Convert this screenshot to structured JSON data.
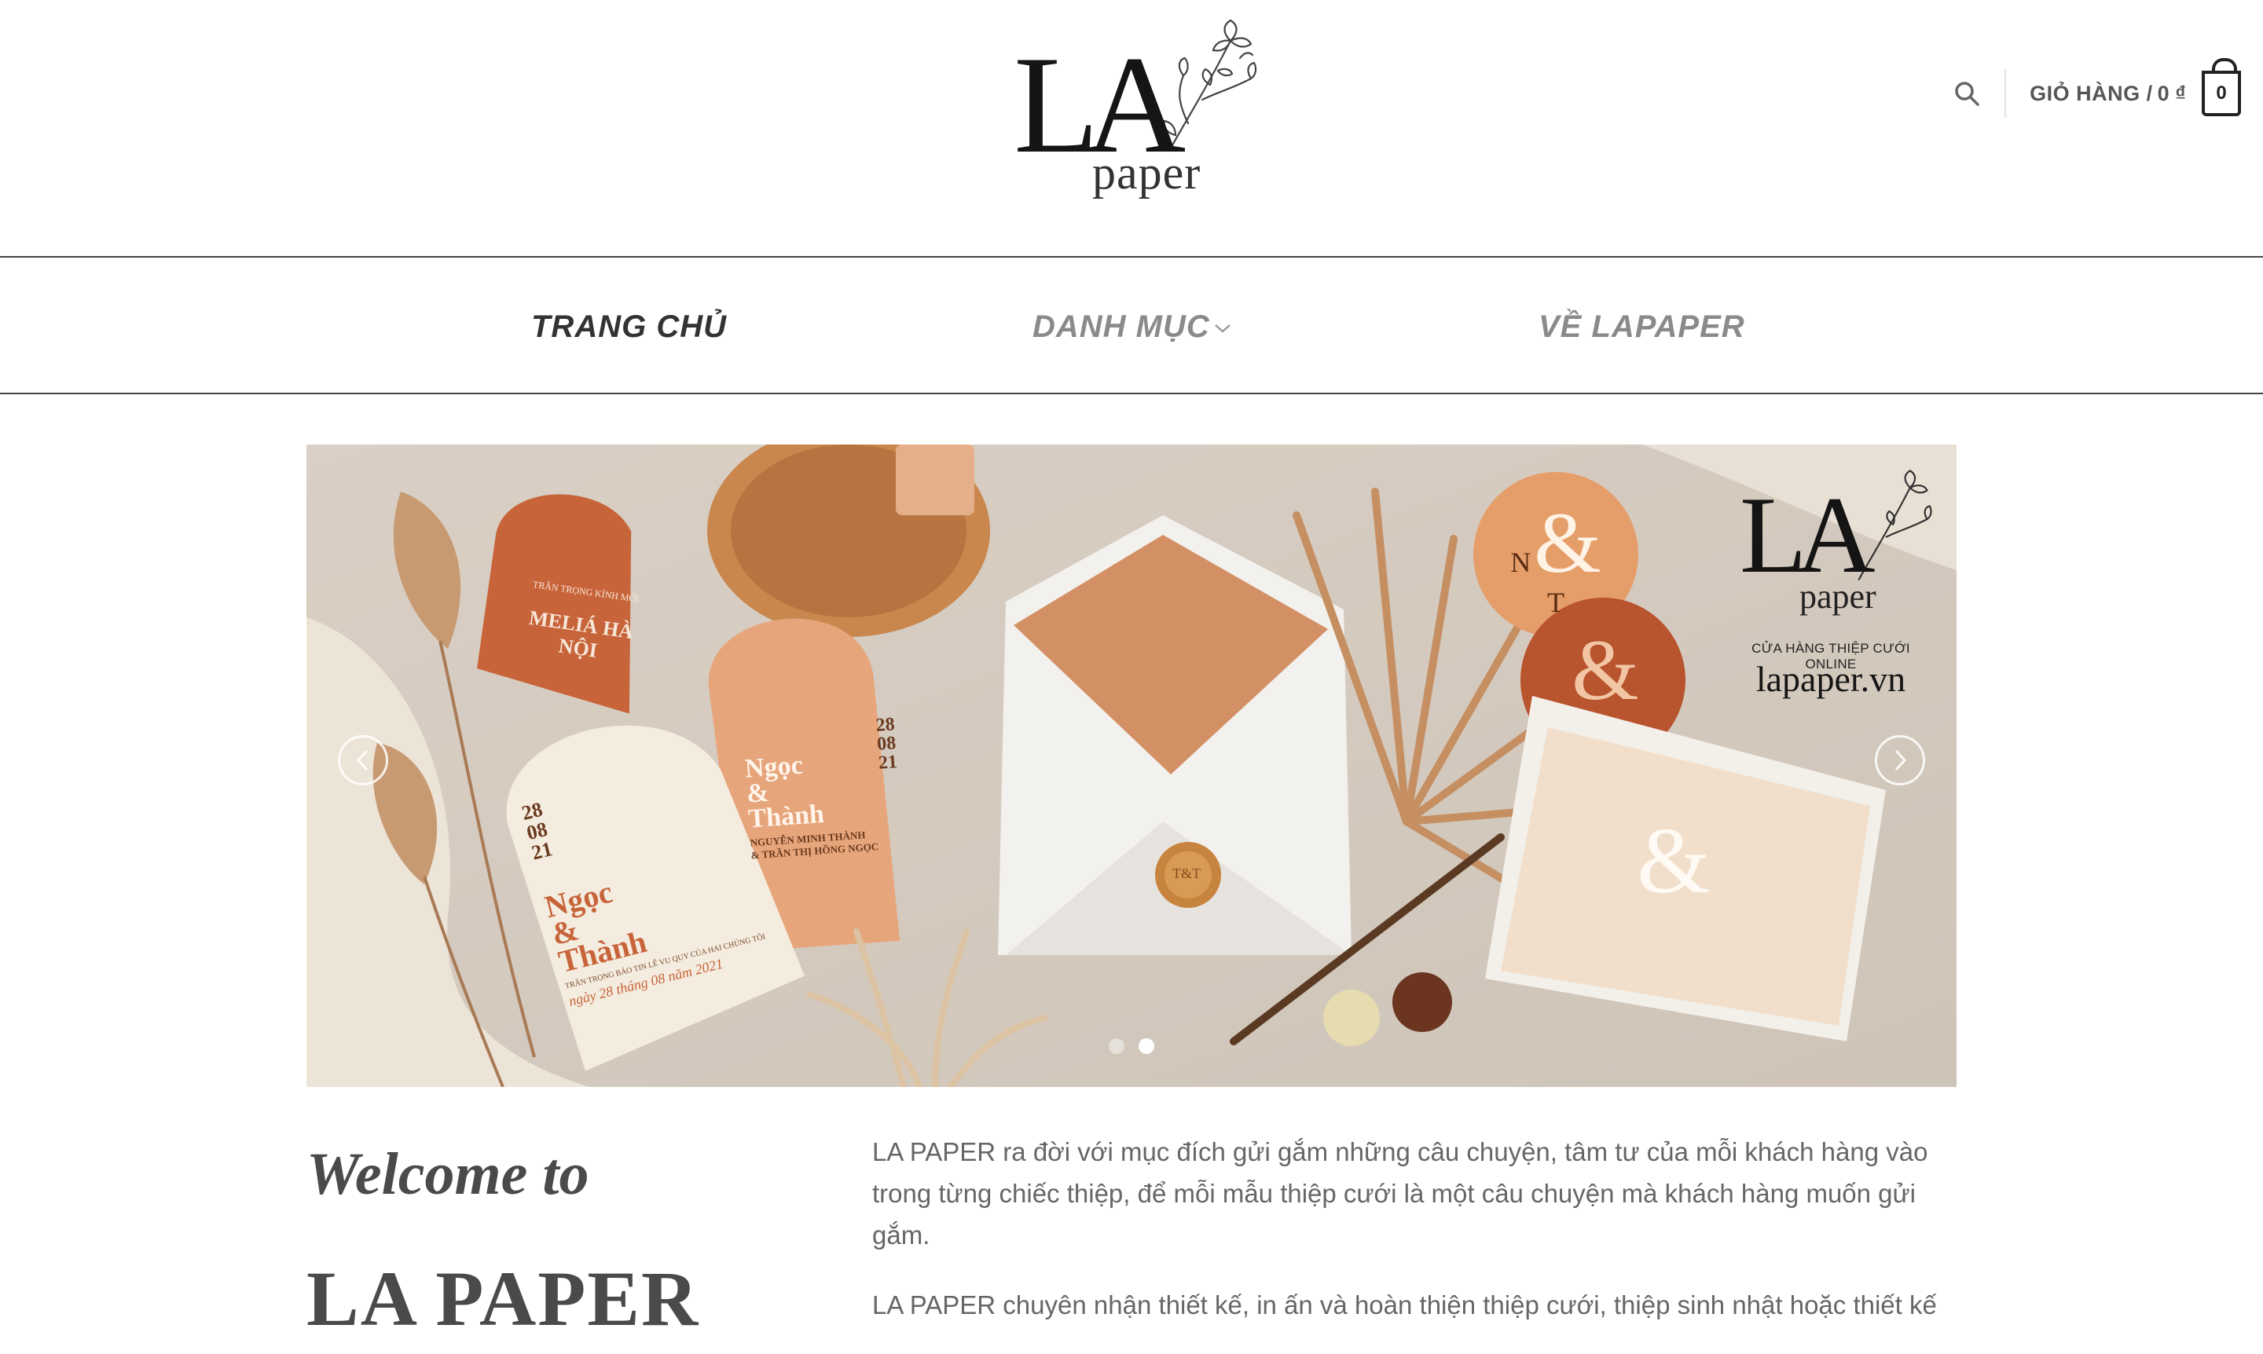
{
  "header": {
    "logo": {
      "main": "LA",
      "sub": "paper"
    },
    "cart": {
      "label": "GIỎ HÀNG /",
      "amount": "0 ₫",
      "count": "0"
    }
  },
  "nav": {
    "items": [
      {
        "label": "TRANG CHỦ",
        "active": true
      },
      {
        "label": "DANH MỤC",
        "active": false,
        "has_dropdown": true
      },
      {
        "label": "VỀ LAPAPER",
        "active": false
      }
    ]
  },
  "slider": {
    "brand": {
      "main": "LA",
      "sub": "paper",
      "tagline": "CỬA HÀNG THIỆP CƯỚI ONLINE",
      "url": "lapaper.vn"
    },
    "cards": {
      "card1": {
        "lines": [
          "TRÂN TRỌNG KÍNH MỜI",
          "MELIÁ HÀ NỘI"
        ]
      },
      "card2": {
        "date": [
          "28",
          "08",
          "21"
        ],
        "names": [
          "Ngọc",
          "&",
          "Thành"
        ],
        "lines": [
          "TRÂN TRỌNG BÁO TIN LỄ VU QUY CỦA HAI CHÚNG TÔI",
          "ngày 28 tháng 08 năm 2021"
        ]
      },
      "card3": {
        "date": [
          "28",
          "08",
          "21"
        ],
        "names": [
          "Ngọc",
          "&",
          "Thành"
        ],
        "lines": [
          "NGUYỄN MINH THÀNH",
          "& TRẦN THỊ HỒNG NGỌC"
        ]
      },
      "monogram": [
        "N",
        "&",
        "T"
      ],
      "stamp": "T&T"
    },
    "active_slide": 2,
    "slide_count": 2
  },
  "content": {
    "welcome": "Welcome to",
    "brand_heading": "LA PAPER",
    "paragraphs": [
      "LA PAPER ra đời với mục đích gửi gắm những câu chuyện, tâm tư của mỗi khách hàng vào trong từng chiếc thiệp, để mỗi mẫu thiệp cưới là một câu chuyện mà khách hàng muốn gửi gắm.",
      "LA PAPER chuyên nhận thiết kế, in ấn và hoàn thiện thiệp cưới, thiệp sinh nhật hoặc thiết kế"
    ]
  },
  "colors": {
    "accent": "#c8643a",
    "nav_active": "#333333",
    "nav_inactive": "#8a8a8a"
  }
}
